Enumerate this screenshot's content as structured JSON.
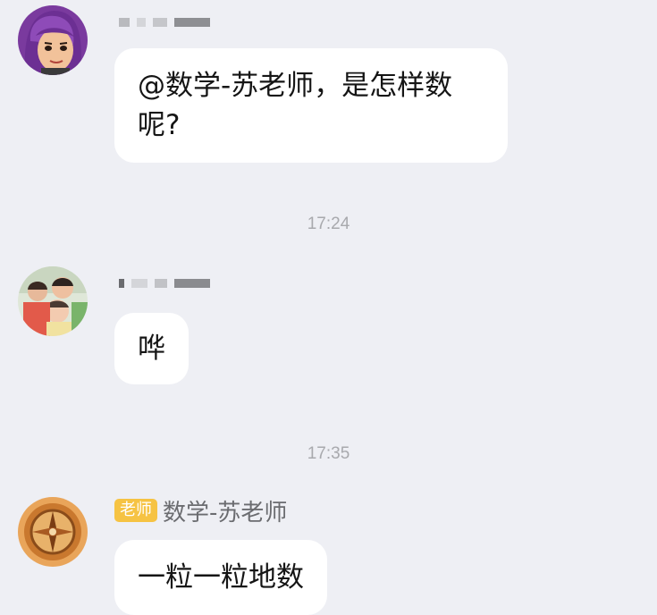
{
  "messages": [
    {
      "text": "@数学-苏老师，是怎样数呢?"
    },
    {
      "text": "哗"
    },
    {
      "badge": "老师",
      "sender": "数学-苏老师",
      "text": "一粒一粒地数"
    }
  ],
  "timestamps": [
    "17:24",
    "17:35"
  ],
  "colors": {
    "background": "#eeeff4",
    "bubble": "#ffffff",
    "badge": "#f6c343",
    "timestamp": "#a8a9ad"
  },
  "avatars": [
    "cartoon-purple-hair-avatar",
    "children-photo-avatar",
    "compass-avatar"
  ]
}
